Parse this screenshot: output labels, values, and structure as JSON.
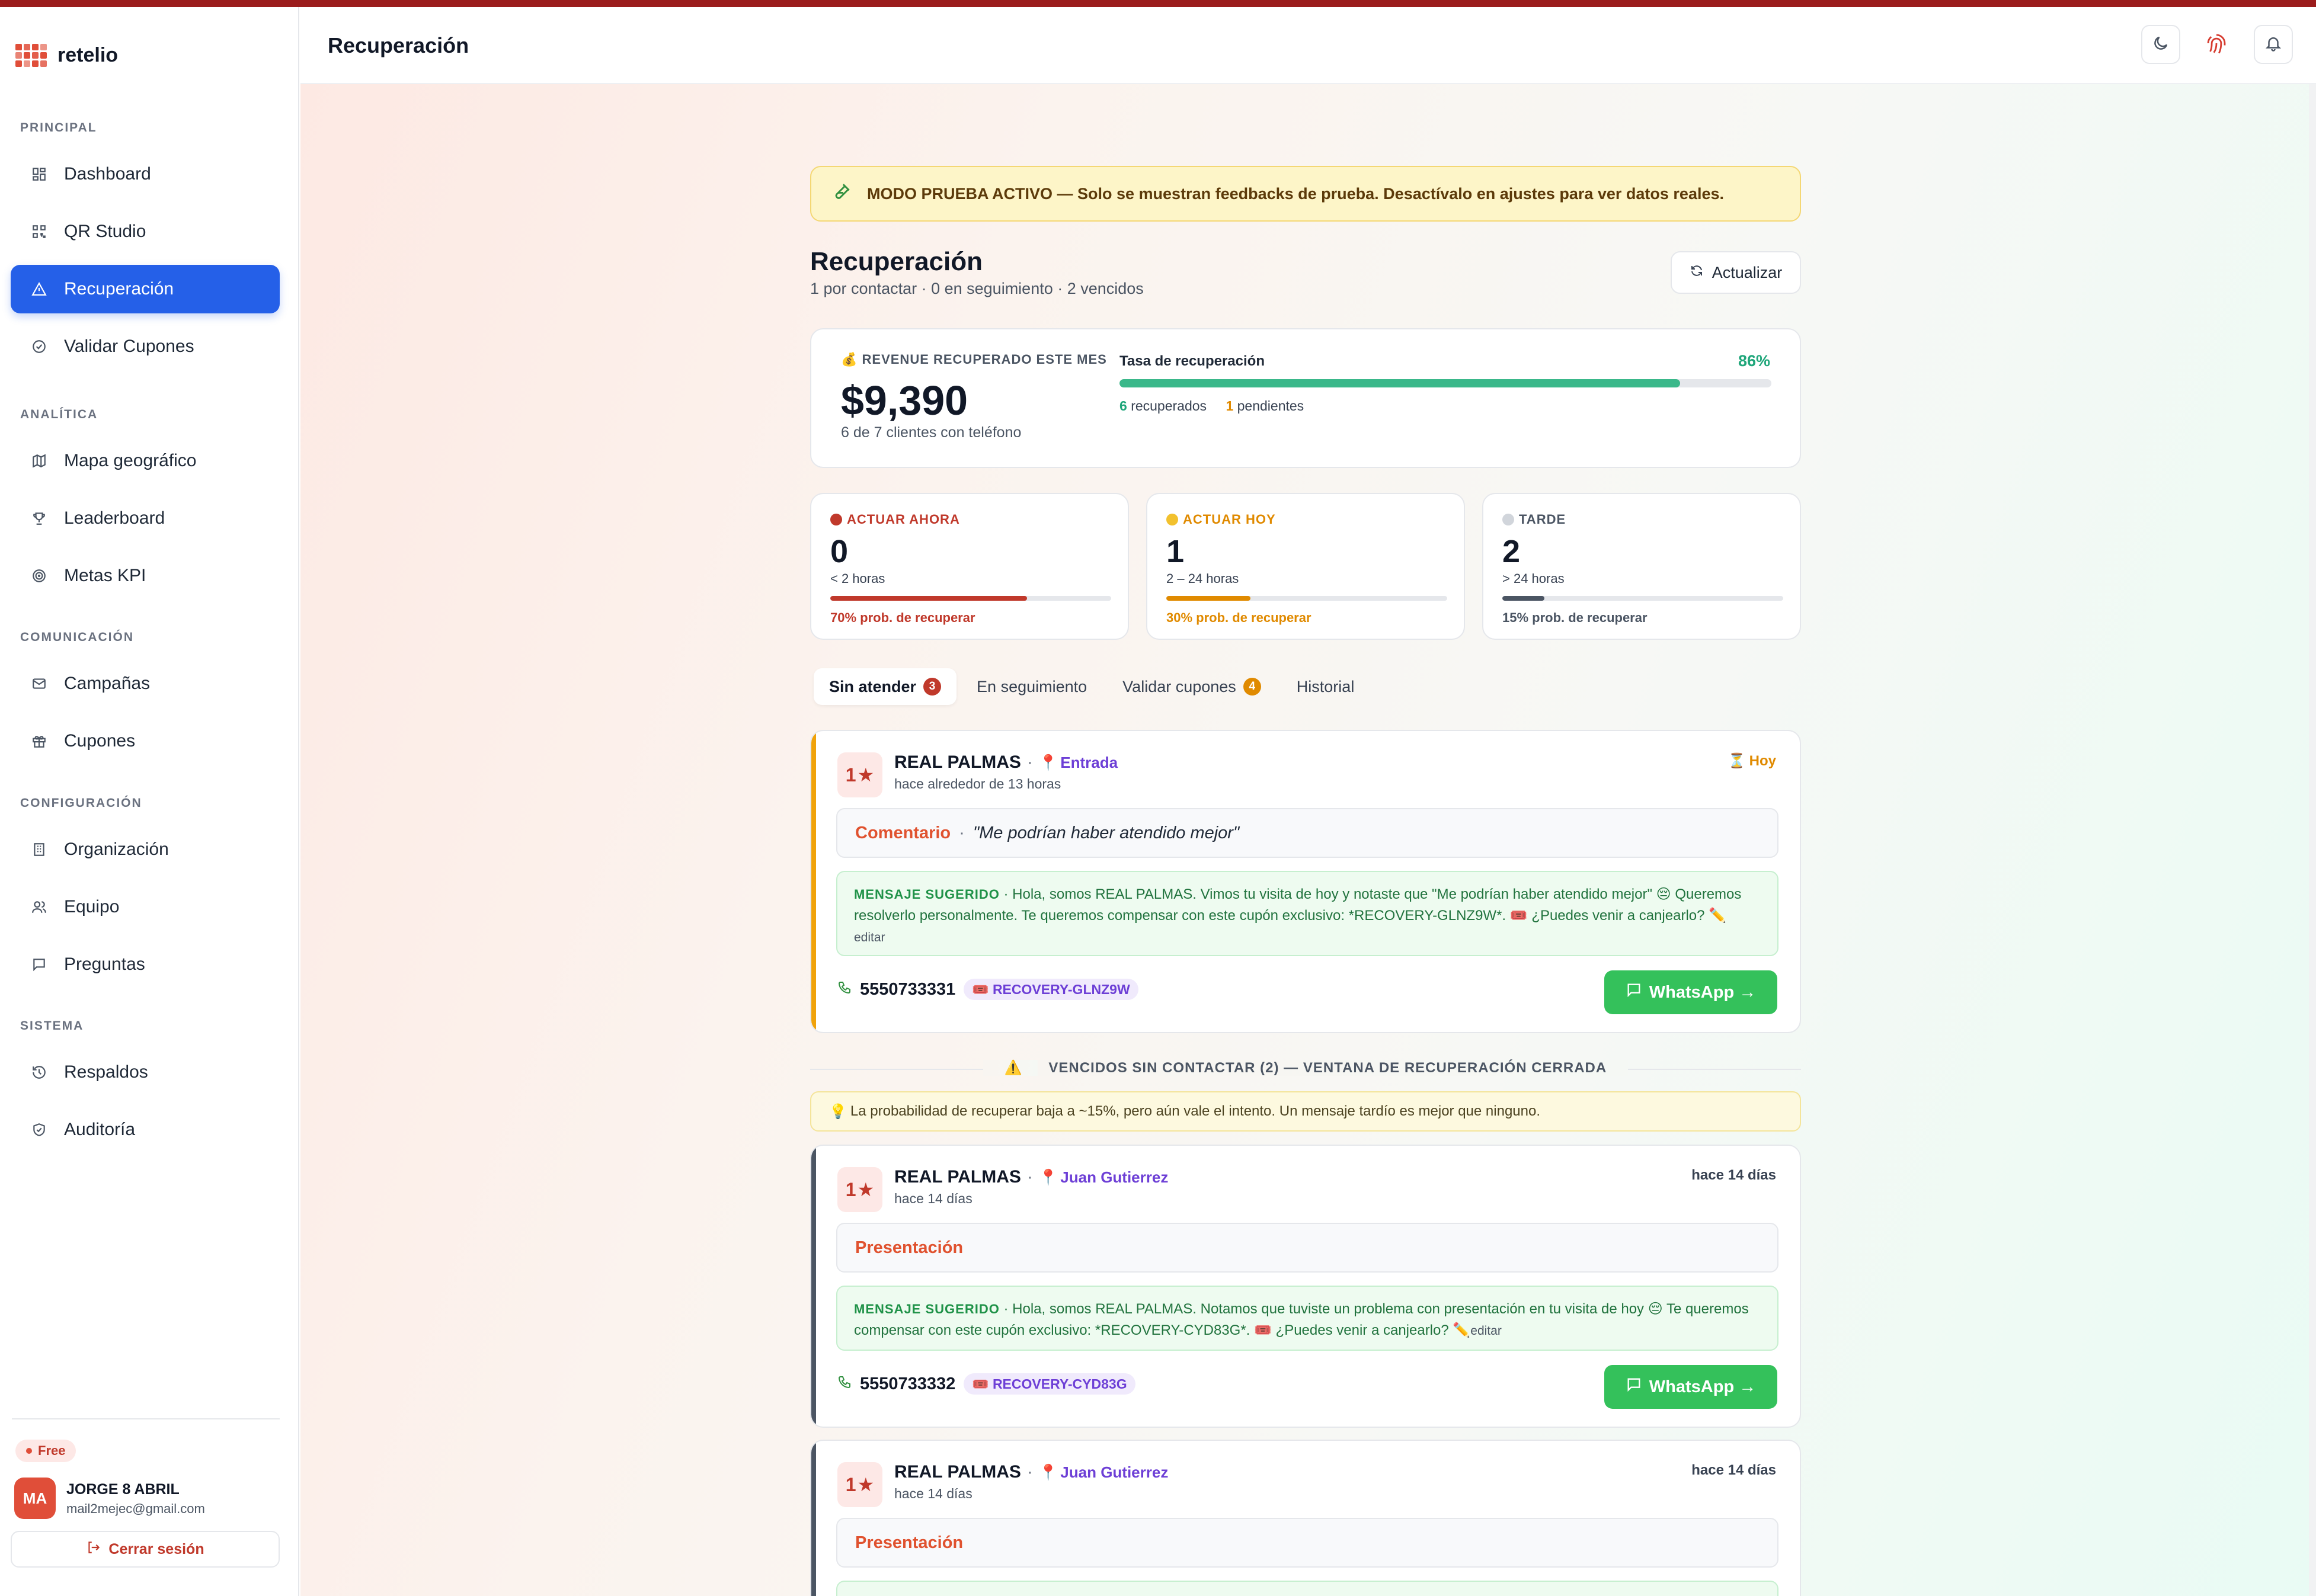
{
  "app": {
    "name": "retelio",
    "header_title": "Recuperación"
  },
  "sidebar": {
    "sections": [
      {
        "label": "PRINCIPAL"
      },
      {
        "label": "ANALÍTICA"
      },
      {
        "label": "COMUNICACIÓN"
      },
      {
        "label": "CONFIGURACIÓN"
      },
      {
        "label": "SISTEMA"
      }
    ],
    "items": [
      {
        "label": "Dashboard",
        "icon": "dashboard-icon"
      },
      {
        "label": "QR Studio",
        "icon": "qr-icon"
      },
      {
        "label": "Recuperación",
        "icon": "alert-triangle-icon",
        "active": true
      },
      {
        "label": "Validar Cupones",
        "icon": "check-circle-icon"
      },
      {
        "label": "Mapa geográfico",
        "icon": "map-icon"
      },
      {
        "label": "Leaderboard",
        "icon": "trophy-icon"
      },
      {
        "label": "Metas KPI",
        "icon": "target-icon"
      },
      {
        "label": "Campañas",
        "icon": "mail-icon"
      },
      {
        "label": "Cupones",
        "icon": "gift-icon"
      },
      {
        "label": "Organización",
        "icon": "building-icon"
      },
      {
        "label": "Equipo",
        "icon": "users-icon"
      },
      {
        "label": "Preguntas",
        "icon": "message-square-icon"
      },
      {
        "label": "Respaldos",
        "icon": "history-icon"
      },
      {
        "label": "Auditoría",
        "icon": "shield-check-icon"
      }
    ],
    "plan": "Free",
    "user": {
      "initials": "MA",
      "name": "JORGE 8 ABRIL",
      "email": "mail2mejec@gmail.com"
    },
    "logout_label": "Cerrar sesión"
  },
  "test_banner": "MODO PRUEBA ACTIVO — Solo se muestran feedbacks de prueba. Desactívalo en ajustes para ver datos reales.",
  "page": {
    "title": "Recuperación",
    "subtitle": "1 por contactar · 0 en seguimiento · 2 vencidos",
    "refresh_label": "Actualizar"
  },
  "revenue": {
    "label": "REVENUE RECUPERADO ESTE MES",
    "amount": "$9,390",
    "sub": "6 de 7 clientes con teléfono",
    "rate_label": "Tasa de recuperación",
    "rate_pct": "86%",
    "rate_value": 0.86,
    "recovered_count": "6",
    "recovered_label": "recuperados",
    "pending_count": "1",
    "pending_label": "pendientes"
  },
  "priorities": [
    {
      "label": "ACTUAR AHORA",
      "count": "0",
      "window": "< 2 horas",
      "prob": "70% prob. de recuperar",
      "prob_value": 0.7,
      "color": "#c0392b",
      "dot": "#c0392b"
    },
    {
      "label": "ACTUAR HOY",
      "count": "1",
      "window": "2 – 24 horas",
      "prob": "30% prob. de recuperar",
      "prob_value": 0.3,
      "color": "#e08a00",
      "dot": "#f2c12e"
    },
    {
      "label": "TARDE",
      "count": "2",
      "window": "> 24 horas",
      "prob": "15% prob. de recuperar",
      "prob_value": 0.15,
      "color": "#4b5563",
      "dot": "#d1d5db"
    }
  ],
  "tabs": [
    {
      "label": "Sin atender",
      "badge": "3",
      "badge_color": "#c0392b",
      "active": true
    },
    {
      "label": "En seguimiento",
      "badge": "",
      "active": false
    },
    {
      "label": "Validar cupones",
      "badge": "4",
      "badge_color": "#e08a00",
      "active": false
    },
    {
      "label": "Historial",
      "badge": "",
      "active": false
    }
  ],
  "feedbacks": [
    {
      "rating": "1",
      "business": "REAL PALMAS",
      "location": "Entrada",
      "time": "hace alrededor de 13 horas",
      "status": "Hoy",
      "comment_kind": "Comentario",
      "comment_quote": "\"Me podrían haber atendido mejor\"",
      "msg_label": "MENSAJE SUGERIDO",
      "message": "Hola, somos REAL PALMAS. Vimos tu visita de hoy y notaste que \"Me podrían haber atendido mejor\" 😔 Queremos resolverlo personalmente. Te queremos compensar con este cupón exclusivo: *RECOVERY-GLNZ9W*. 🎟️ ¿Puedes venir a canjearlo?",
      "edit": "editar",
      "phone": "5550733331",
      "code": "RECOVERY-GLNZ9W",
      "whatsapp": "WhatsApp →"
    },
    {
      "rating": "1",
      "business": "REAL PALMAS",
      "location": "Juan Gutierrez",
      "time": "hace 14 días",
      "status": "hace 14 días",
      "comment_kind": "Presentación",
      "comment_quote": "",
      "msg_label": "MENSAJE SUGERIDO",
      "message": "Hola, somos REAL PALMAS. Notamos que tuviste un problema con presentación en tu visita de hoy 😔 Te queremos compensar con este cupón exclusivo: *RECOVERY-CYD83G*. 🎟️ ¿Puedes venir a canjearlo?",
      "edit": "editar",
      "phone": "5550733332",
      "code": "RECOVERY-CYD83G",
      "whatsapp": "WhatsApp →"
    },
    {
      "rating": "1",
      "business": "REAL PALMAS",
      "location": "Juan Gutierrez",
      "time": "hace 14 días",
      "status": "hace 14 días",
      "comment_kind": "Presentación"
    }
  ],
  "overdue": {
    "title": "VENCIDOS SIN CONTACTAR (2) — VENTANA DE RECUPERACIÓN CERRADA",
    "note": "La probabilidad de recuperar baja a ~15%, pero aún vale el intento. Un mensaje tardío es mejor que ninguno."
  },
  "colors": {
    "accent": "#2560e8",
    "brand": "#e04e39",
    "success": "#34c15b",
    "warning": "#e08a00"
  }
}
